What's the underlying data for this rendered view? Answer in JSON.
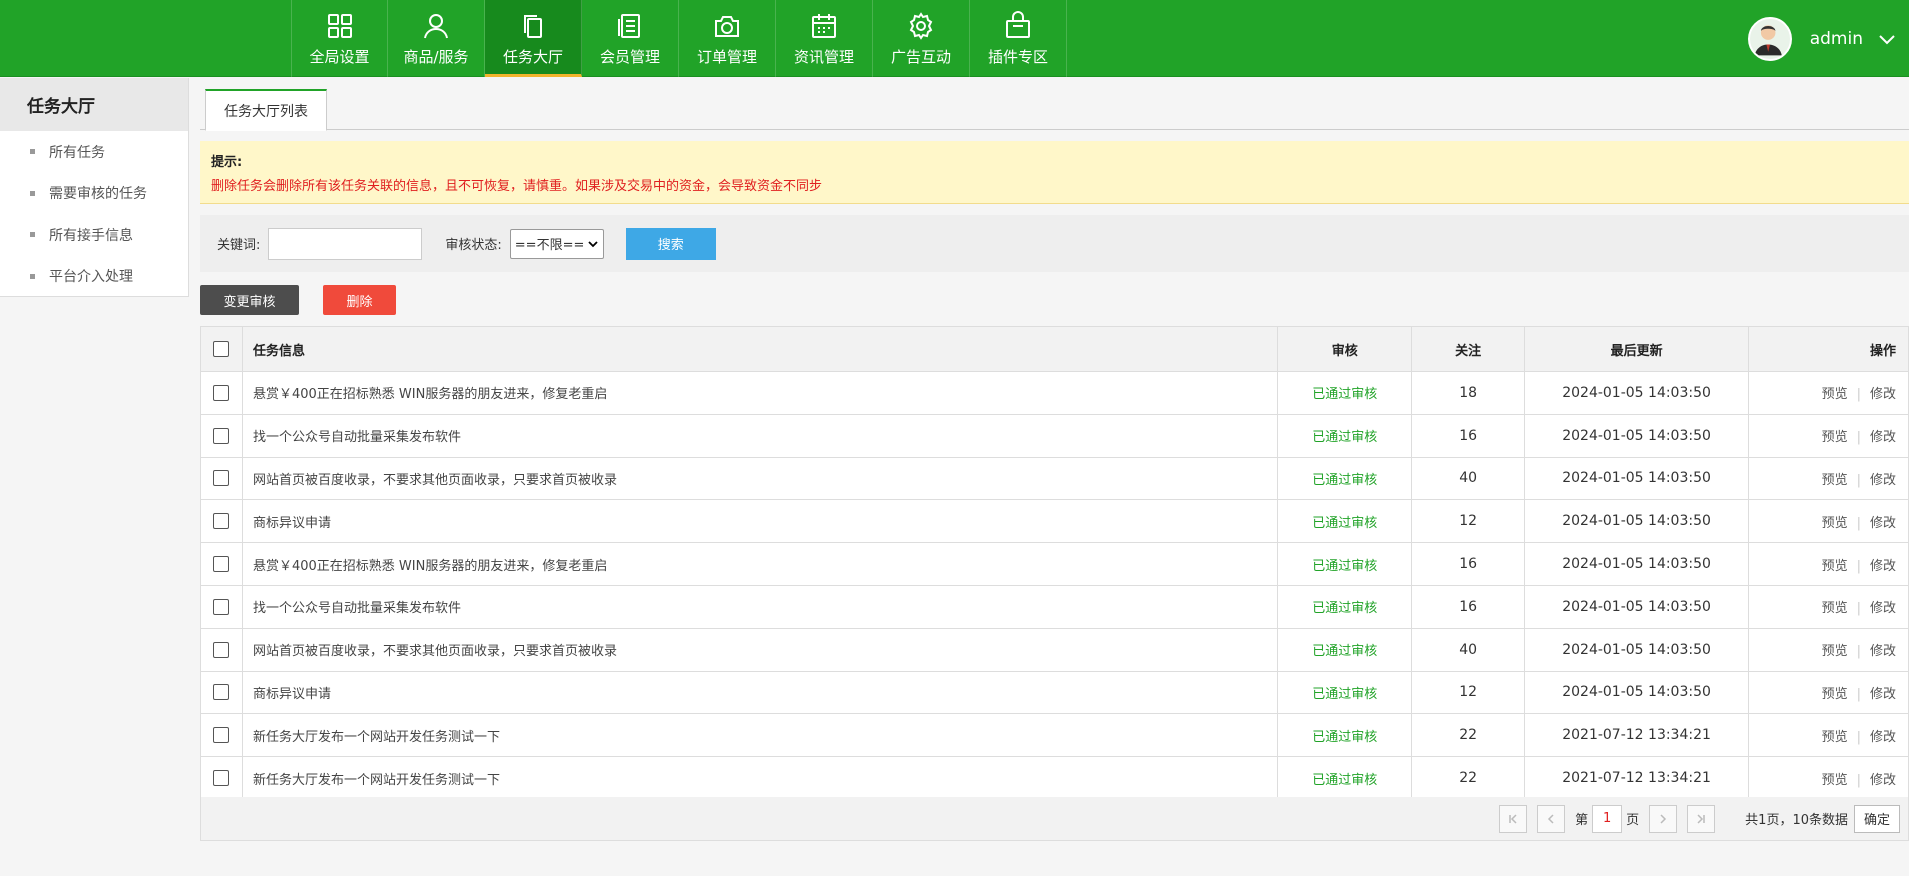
{
  "nav": {
    "items": [
      {
        "label": "全局设置",
        "icon": "grid-icon"
      },
      {
        "label": "商品/服务",
        "icon": "user-icon"
      },
      {
        "label": "任务大厅",
        "icon": "copy-icon",
        "active": true
      },
      {
        "label": "会员管理",
        "icon": "list-icon"
      },
      {
        "label": "订单管理",
        "icon": "camera-icon"
      },
      {
        "label": "资讯管理",
        "icon": "calendar-icon"
      },
      {
        "label": "广告互动",
        "icon": "gear-icon"
      },
      {
        "label": "插件专区",
        "icon": "bag-icon"
      }
    ],
    "user": "admin"
  },
  "sidebar": {
    "title": "任务大厅",
    "items": [
      "所有任务",
      "需要审核的任务",
      "所有接手信息",
      "平台介入处理"
    ]
  },
  "tabs": {
    "active": "任务大厅列表"
  },
  "notice": {
    "title": "提示:",
    "text": "删除任务会删除所有该任务关联的信息，且不可恢复，请慎重。如果涉及交易中的资金，会导致资金不同步"
  },
  "search": {
    "keyword_label": "关键词:",
    "keyword_value": "",
    "status_label": "审核状态:",
    "status_value": "==不限==",
    "button": "搜索"
  },
  "actions": {
    "change": "变更审核",
    "delete": "删除"
  },
  "table": {
    "headers": {
      "info": "任务信息",
      "audit": "审核",
      "follow": "关注",
      "updated": "最后更新",
      "ops": "操作"
    },
    "op_preview": "预览",
    "op_edit": "修改",
    "op_sep": "|",
    "rows": [
      {
        "title": "悬赏￥400正在招标熟悉 WIN服务器的朋友进来，修复老重启",
        "status": "已通过审核",
        "follow": "18",
        "updated": "2024-01-05 14:03:50"
      },
      {
        "title": "找一个公众号自动批量采集发布软件",
        "status": "已通过审核",
        "follow": "16",
        "updated": "2024-01-05 14:03:50"
      },
      {
        "title": "网站首页被百度收录，不要求其他页面收录，只要求首页被收录",
        "status": "已通过审核",
        "follow": "40",
        "updated": "2024-01-05 14:03:50"
      },
      {
        "title": "商标异议申请",
        "status": "已通过审核",
        "follow": "12",
        "updated": "2024-01-05 14:03:50"
      },
      {
        "title": "悬赏￥400正在招标熟悉 WIN服务器的朋友进来，修复老重启",
        "status": "已通过审核",
        "follow": "16",
        "updated": "2024-01-05 14:03:50"
      },
      {
        "title": "找一个公众号自动批量采集发布软件",
        "status": "已通过审核",
        "follow": "16",
        "updated": "2024-01-05 14:03:50"
      },
      {
        "title": "网站首页被百度收录，不要求其他页面收录，只要求首页被收录",
        "status": "已通过审核",
        "follow": "40",
        "updated": "2024-01-05 14:03:50"
      },
      {
        "title": "商标异议申请",
        "status": "已通过审核",
        "follow": "12",
        "updated": "2024-01-05 14:03:50"
      },
      {
        "title": "新任务大厅发布一个网站开发任务测试一下",
        "status": "已通过审核",
        "follow": "22",
        "updated": "2021-07-12 13:34:21"
      },
      {
        "title": "新任务大厅发布一个网站开发任务测试一下",
        "status": "已通过审核",
        "follow": "22",
        "updated": "2021-07-12 13:34:21"
      }
    ]
  },
  "pager": {
    "page_prefix": "第",
    "page": "1",
    "page_suffix": "页",
    "total": "共1页，10条数据",
    "confirm": "确定"
  }
}
